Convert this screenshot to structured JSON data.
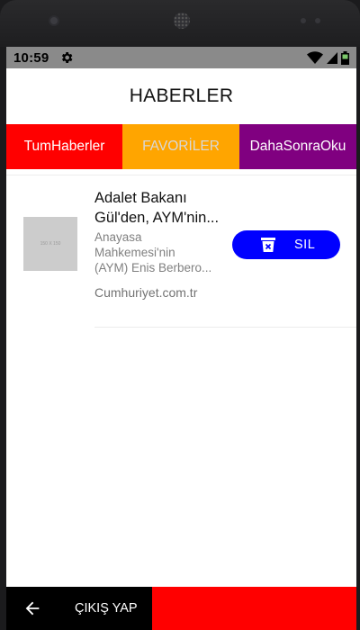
{
  "status_bar": {
    "time": "10:59",
    "icons": [
      "gear-icon",
      "wifi-icon",
      "signal-icon",
      "battery-icon"
    ]
  },
  "header": {
    "title": "HABERLER"
  },
  "tabs": [
    {
      "label": "TumHaberler",
      "color": "#ff0000"
    },
    {
      "label": "FAVORİLER",
      "color": "#ffa500"
    },
    {
      "label": "DahaSonraOku",
      "color": "#800080"
    }
  ],
  "news_items": [
    {
      "thumbnail_text": "150 X 150",
      "title_line1": "Adalet Bakanı",
      "title_line2": "Gül'den, AYM'nin...",
      "desc_line1": "Anayasa",
      "desc_line2": "Mahkemesi'nin",
      "desc_line3": "(AYM) Enis Berbero...",
      "source": "Cumhuriyet.com.tr",
      "delete_label": "SIL",
      "delete_icon": "trash-icon"
    }
  ],
  "bottom_bar": {
    "back_icon": "arrow-left-icon",
    "logout_label": "ÇIKIŞ YAP"
  },
  "colors": {
    "accent_blue": "#0000ff",
    "red": "#ff0000",
    "orange": "#ffa500",
    "purple": "#800080"
  }
}
